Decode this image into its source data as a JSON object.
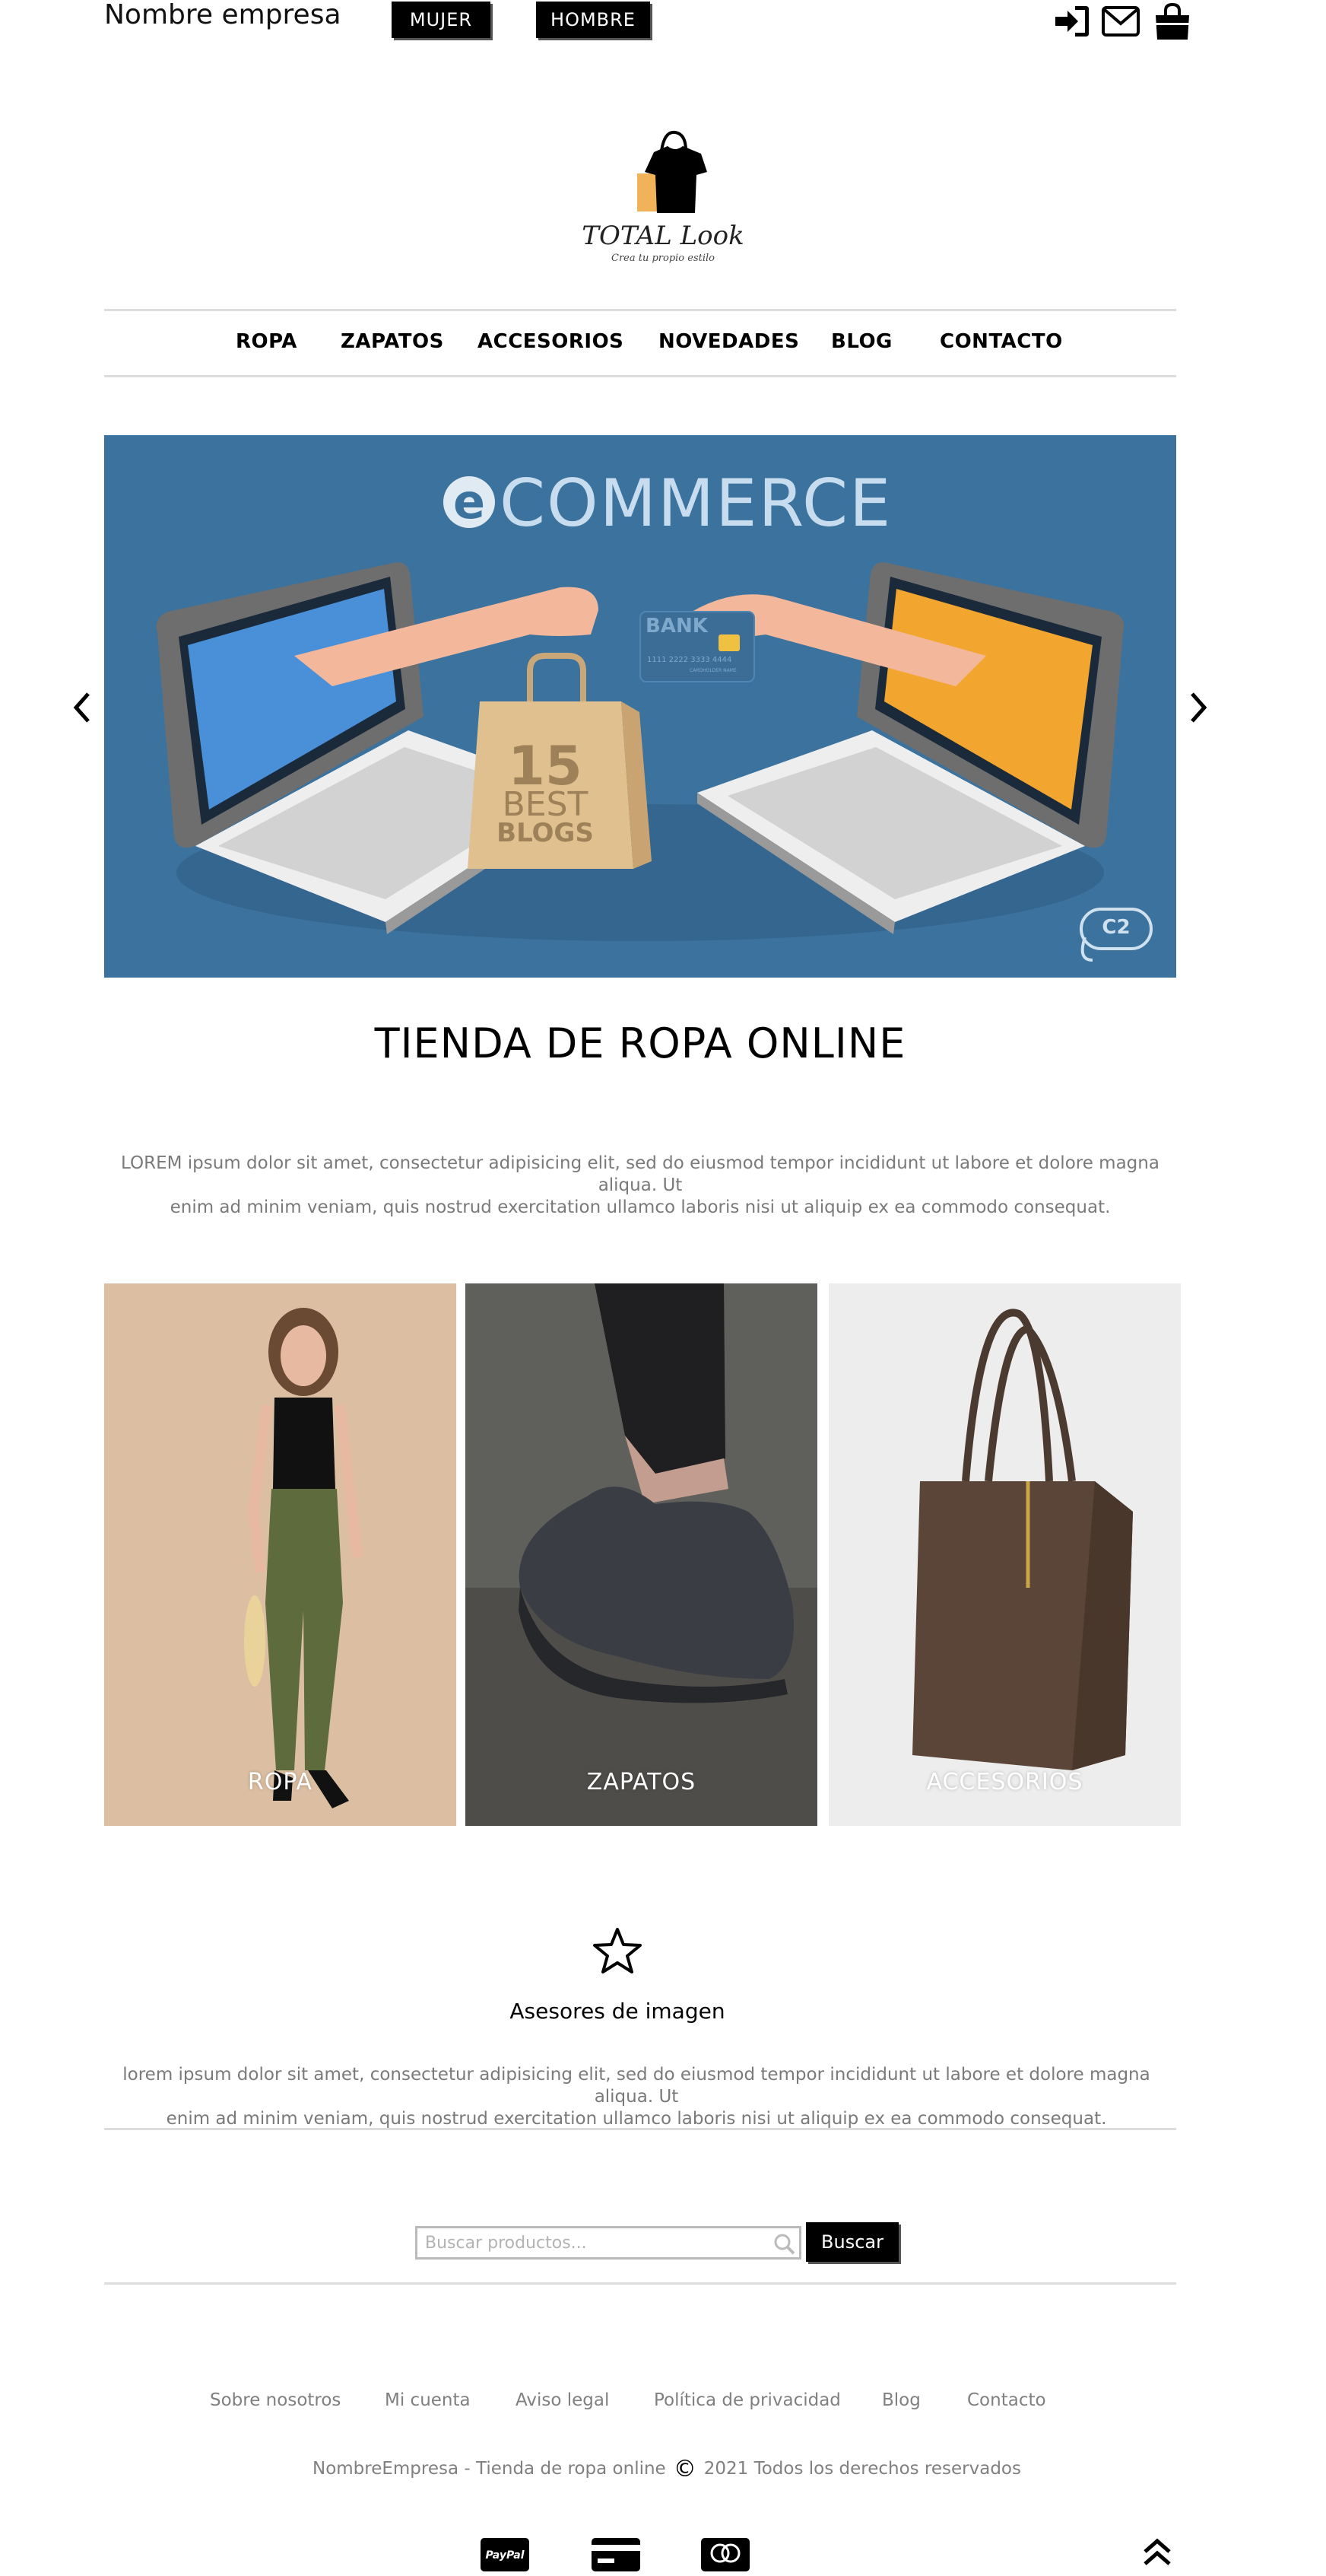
{
  "header": {
    "brand": "Nombre empresa",
    "gender_buttons": [
      "MUJER",
      "HOMBRE"
    ],
    "icons": [
      "sign-in-icon",
      "envelope-icon",
      "shopping-bag-icon"
    ]
  },
  "logo": {
    "title": "TOTAL Look",
    "subtitle": "Crea tu propio estilo",
    "icon": "t-shirt-bag-icon"
  },
  "nav": {
    "items": [
      "ROPA",
      "ZAPATOS",
      "ACCESORIOS",
      "NOVEDADES",
      "BLOG",
      "CONTACTO"
    ]
  },
  "banner": {
    "title": "COMMERCE",
    "title_prefix": "e",
    "bag_number": "15",
    "bag_text_1": "BEST",
    "bag_text_2": "BLOGS",
    "card_text": "BANK",
    "card_number": "1111 2222 3333 4444",
    "card_holder": "CARDHOLDER NAME",
    "badge": "C2",
    "colors": {
      "background": "#3c729e",
      "left_screen": "#4a90d9",
      "right_screen": "#f2a630"
    }
  },
  "hero": {
    "heading": "TIENDA DE ROPA ONLINE",
    "text_line1": "LOREM ipsum dolor sit amet, consectetur adipisicing elit, sed do eiusmod tempor incididunt ut labore et dolore magna aliqua. Ut",
    "text_line2": "enim ad minim veniam, quis nostrud exercitation ullamco laboris nisi ut aliquip ex ea commodo consequat."
  },
  "categories": [
    {
      "label": "ROPA",
      "color": "#d9b89c"
    },
    {
      "label": "ZAPATOS",
      "color": "#5f5f5b"
    },
    {
      "label": "ACCESORIOS",
      "color": "#ececec"
    }
  ],
  "advisor": {
    "icon": "star-icon",
    "heading": "Asesores de imagen",
    "text_line1": "lorem ipsum dolor sit amet, consectetur adipisicing elit, sed do eiusmod tempor incididunt ut labore et dolore magna aliqua. Ut",
    "text_line2": "enim ad minim veniam, quis nostrud exercitation ullamco laboris nisi ut aliquip ex ea commodo consequat."
  },
  "search": {
    "placeholder": "Buscar productos...",
    "button": "Buscar"
  },
  "footer": {
    "links": [
      "Sobre nosotros",
      "Mi cuenta",
      "Aviso legal",
      "Política de privacidad",
      "Blog",
      "Contacto"
    ],
    "copyright_left": "NombreEmpresa - Tienda de ropa online",
    "copyright_symbol": "©",
    "copyright_right": "2021 Todos los derechos reservados",
    "payments": [
      "PayPal",
      "credit-card-icon",
      "mastercard"
    ],
    "back_to_top_icon": "double-chevron-up-icon"
  }
}
